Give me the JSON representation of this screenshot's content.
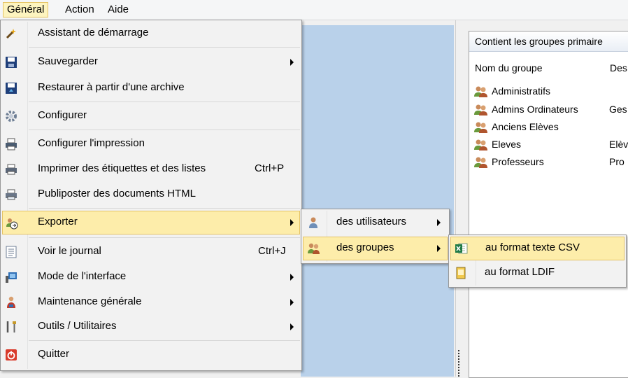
{
  "menubar": {
    "items": [
      {
        "label": "Général"
      },
      {
        "label": "Action"
      },
      {
        "label": "Aide"
      }
    ]
  },
  "main_menu": {
    "items": [
      {
        "label": "Assistant de démarrage",
        "icon": "wand-icon"
      },
      {
        "label": "Sauvegarder",
        "icon": "save-icon"
      },
      {
        "label": "Restaurer à partir d'une archive",
        "icon": "restore-icon"
      },
      {
        "label": "Configurer",
        "icon": "gear-icon"
      },
      {
        "label": "Configurer l'impression",
        "icon": "printer-settings-icon"
      },
      {
        "label": "Imprimer des étiquettes et des listes",
        "shortcut": "Ctrl+P",
        "icon": "printer-icon"
      },
      {
        "label": "Publiposter des documents HTML",
        "icon": "mail-merge-icon"
      },
      {
        "label": "Exporter",
        "icon": "export-icon"
      },
      {
        "label": "Voir le journal",
        "shortcut": "Ctrl+J",
        "icon": "log-icon"
      },
      {
        "label": "Mode de l'interface",
        "icon": "interface-mode-icon"
      },
      {
        "label": "Maintenance générale",
        "icon": "maintenance-icon"
      },
      {
        "label": "Outils / Utilitaires",
        "icon": "tools-icon"
      },
      {
        "label": "Quitter",
        "icon": "power-icon"
      }
    ]
  },
  "export_submenu": {
    "items": [
      {
        "label": "des utilisateurs",
        "icon": "user-icon"
      },
      {
        "label": "des groupes",
        "icon": "group-icon"
      }
    ]
  },
  "groups_submenu": {
    "items": [
      {
        "label": "au format texte CSV",
        "icon": "excel-csv-icon"
      },
      {
        "label": "au format LDIF",
        "icon": "ldif-file-icon"
      }
    ]
  },
  "right_panel": {
    "header": "Contient les groupes primaire",
    "columns": [
      "Nom du groupe",
      "Des"
    ],
    "rows": [
      {
        "name": "Administratifs",
        "desc": ""
      },
      {
        "name": "Admins Ordinateurs",
        "desc": "Ges"
      },
      {
        "name": "Anciens Elèves",
        "desc": ""
      },
      {
        "name": "Eleves",
        "desc": "Elèv"
      },
      {
        "name": "Professeurs",
        "desc": "Pro"
      }
    ]
  },
  "colors": {
    "highlight_bg": "#fdedaa",
    "highlight_border": "#e5c365",
    "workspace_blue": "#b9d1ea",
    "menu_bg": "#f2f2f2"
  }
}
